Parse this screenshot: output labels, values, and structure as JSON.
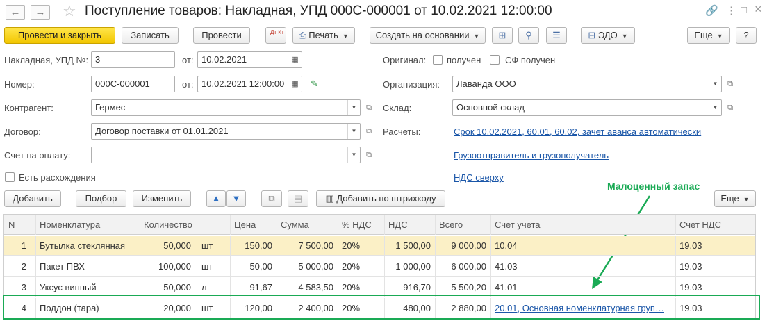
{
  "window": {
    "title": "Поступление товаров: Накладная, УПД 000С-000001 от 10.02.2021 12:00:00",
    "nav_back": "←",
    "nav_forward": "→",
    "link_icon": "🔗",
    "menu_icon": "⋮",
    "minimize_icon": "□",
    "close_icon": "×"
  },
  "toolbar": {
    "post_close": "Провести и закрыть",
    "save": "Записать",
    "post": "Провести",
    "dtkt": "Дт Кт",
    "print": "Печать",
    "create_based": "Создать на основании",
    "edo": "ЭДО",
    "more": "Еще",
    "help": "?"
  },
  "form": {
    "invoice_label": "Накладная, УПД №:",
    "invoice_value": "3",
    "from_label": "от:",
    "invoice_date": "10.02.2021",
    "number_label": "Номер:",
    "number_value": "000С-000001",
    "number_from_label": "от:",
    "number_date": "10.02.2021 12:00:00",
    "original_label": "Оригинал:",
    "original_received": "получен",
    "sf_received": "СФ получен",
    "org_label": "Организация:",
    "org_value": "Лаванда ООО",
    "counterparty_label": "Контрагент:",
    "counterparty_value": "Гермес",
    "warehouse_label": "Склад:",
    "warehouse_value": "Основной склад",
    "contract_label": "Договор:",
    "contract_value": "Договор поставки от 01.01.2021",
    "settlements_label": "Расчеты:",
    "settlements_link": "Срок 10.02.2021, 60.01, 60.02, зачет аванса автоматически",
    "invoice_pay_label": "Счет на оплату:",
    "invoice_pay_value": "",
    "shipper_link": "Грузоотправитель и грузополучатель",
    "discrepancy_label": "Есть расхождения",
    "vat_link": "НДС сверху"
  },
  "table_toolbar": {
    "add": "Добавить",
    "pick": "Подбор",
    "edit": "Изменить",
    "barcode": "Добавить по штрихкоду",
    "more": "Еще"
  },
  "annotation": {
    "text": "Малоценный запас",
    "color": "#1aaa55"
  },
  "table": {
    "headers": [
      "N",
      "Номенклатура",
      "Количество",
      "Цена",
      "Сумма",
      "% НДС",
      "НДС",
      "Всего",
      "Счет учета",
      "Счет НДС"
    ],
    "rows": [
      {
        "n": "1",
        "name": "Бутылка стеклянная",
        "qty": "50,000",
        "unit": "шт",
        "price": "150,00",
        "sum": "7 500,00",
        "vat_rate": "20%",
        "vat": "1 500,00",
        "total": "9 000,00",
        "account": "10.04",
        "vat_account": "19.03"
      },
      {
        "n": "2",
        "name": "Пакет ПВХ",
        "qty": "100,000",
        "unit": "шт",
        "price": "50,00",
        "sum": "5 000,00",
        "vat_rate": "20%",
        "vat": "1 000,00",
        "total": "6 000,00",
        "account": "41.03",
        "vat_account": "19.03"
      },
      {
        "n": "3",
        "name": "Уксус винный",
        "qty": "50,000",
        "unit": "л",
        "price": "91,67",
        "sum": "4 583,50",
        "vat_rate": "20%",
        "vat": "916,70",
        "total": "5 500,20",
        "account": "41.01",
        "vat_account": "19.03"
      },
      {
        "n": "4",
        "name": "Поддон (тара)",
        "qty": "20,000",
        "unit": "шт",
        "price": "120,00",
        "sum": "2 400,00",
        "vat_rate": "20%",
        "vat": "480,00",
        "total": "2 880,00",
        "account": "20.01, Основная номенклатурная груп…",
        "vat_account": "19.03"
      }
    ]
  },
  "colors": {
    "primary_button": "#f2c600",
    "selected_row": "#fbf0c6",
    "link": "#1a56a8"
  }
}
